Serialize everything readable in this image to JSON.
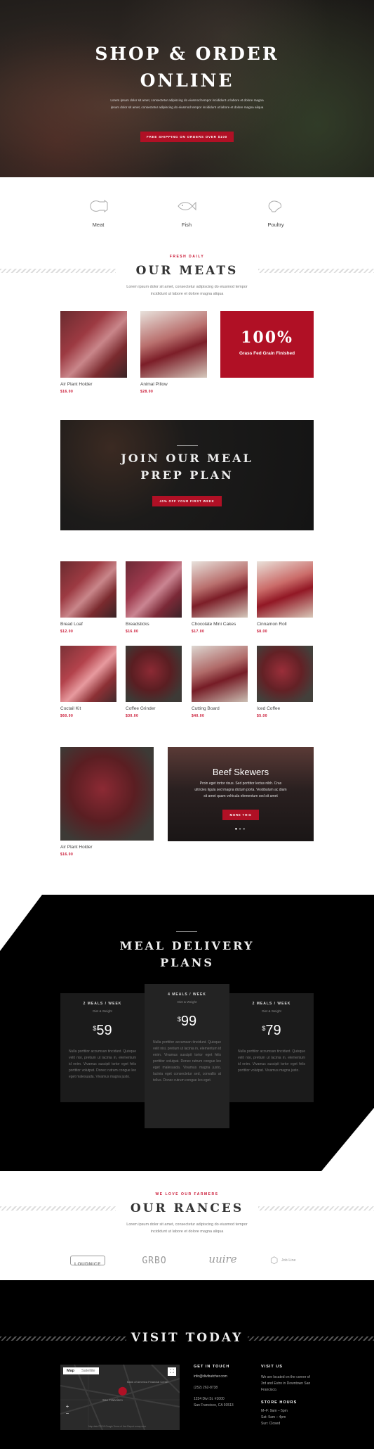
{
  "hero": {
    "title_line1": "SHOP & ORDER",
    "title_line2": "ONLINE",
    "subtitle_line1": "Lorem ipsum dolor sit amet, consectetur adipiscing do eiusmod tempor incididunt ut labore et dolore magna",
    "subtitle_line2": "ipsum dolor sit amet, consectetur adipiscing do eiusmod tempor incididunt ut labore et dolore magna aliqua",
    "cta": "FREE SHIPPING ON ORDERS OVER $100"
  },
  "categories": [
    {
      "label": "Meat",
      "icon": "meat-icon"
    },
    {
      "label": "Fish",
      "icon": "fish-icon"
    },
    {
      "label": "Poultry",
      "icon": "poultry-icon"
    }
  ],
  "meats": {
    "eyebrow": "FRESH DAILY",
    "title": "OUR MEATS",
    "desc_line1": "Lorem ipsum dolor sit amet, consectetur adipiscing do eiusmod tempor",
    "desc_line2": "incididunt ut labore et dolore magna aliqua",
    "products": [
      {
        "name": "Air Plant Holder",
        "price": "$16.00"
      },
      {
        "name": "Animal Pillow",
        "price": "$28.00"
      }
    ],
    "promo_big": "100%",
    "promo_small": "Grass Fed Grain Finished"
  },
  "meal_prep": {
    "title_line1": "JOIN OUR MEAL",
    "title_line2": "PREP PLAN",
    "cta": "40% OFF YOUR FIRST WEEK"
  },
  "grid": [
    {
      "name": "Bread Loaf",
      "price": "$12.00"
    },
    {
      "name": "Breadsticks",
      "price": "$16.00"
    },
    {
      "name": "Chocolate Mini Cakes",
      "price": "$17.00"
    },
    {
      "name": "Cinnamon Roll",
      "price": "$8.00"
    },
    {
      "name": "Coctail Kit",
      "price": "$60.00"
    },
    {
      "name": "Coffee Grinder",
      "price": "$30.00"
    },
    {
      "name": "Cutting Board",
      "price": "$40.00"
    },
    {
      "name": "Iced Coffee",
      "price": "$5.00"
    }
  ],
  "feature_product": {
    "name": "Air Plant Holder",
    "price": "$16.00"
  },
  "slider": {
    "title": "Beef Skewers",
    "text_line1": "Proin eget tortor risus. Sed porttitor lectus nibh. Cras",
    "text_line2": "ultricies ligula sed magna dictum porta. Vestibulum ac diam",
    "text_line3": "sit amet quam vehicula elementum sed sit amet",
    "cta": "MORE THIS"
  },
  "delivery": {
    "title_line1": "MEAL DELIVERY",
    "title_line2": "PLANS",
    "plans": [
      {
        "heading": "2 MEALS / WEEK",
        "sub": "Diet & Weight",
        "currency": "$",
        "price": "59",
        "desc": "Nulla porttitor accumsan tincidunt. Quisque velit nisi, pretium ut lacinia in, elementum id enim. Vivamus suscipit tortor eget felis porttitor volutpat. Donec rutrum congue leo eget malesuada. Vivamus magna justo."
      },
      {
        "heading": "4 MEALS / WEEK",
        "sub": "Diet & Weight",
        "currency": "$",
        "price": "99",
        "desc": "Nulla porttitor accumsan tincidunt. Quisque velit nisi, pretium ut lacinia in, elementum id enim. Vivamus suscipit tortor eget felis porttitor volutpat. Donec rutrum congue leo eget malesuada. Vivamus magna justo, lacinia eget consectetur sed, convallis at tellus. Donec rutrum congue leo eget."
      },
      {
        "heading": "2 MEALS / WEEK",
        "sub": "Diet & Weight",
        "currency": "$",
        "price": "79",
        "desc": "Nulla porttitor accumsan tincidunt. Quisque velit nisi, pretium ut lacinia in, elementum id enim. Vivamus suscipit tortor eget felis porttitor volutpat. Vivamus magna justo."
      }
    ]
  },
  "ranches": {
    "eyebrow": "WE LOVE OUR FARMERS",
    "title": "OUR RANCES",
    "desc_line1": "Lorem ipsum dolor sit amet, consectetur adipiscing do eiusmod tempor",
    "desc_line2": "incididunt ut labore et dolore magna aliqua",
    "logos": [
      "LOUDNICE",
      "GRBO",
      "uuire",
      "Job Line"
    ]
  },
  "visit": {
    "title": "VISIT TODAY",
    "map": {
      "tab_map": "Map",
      "tab_satellite": "Satellite",
      "label1": "San Francisco",
      "label2": "Bank of America Financial Center",
      "footer": "Map data ©2019 Google  Terms of Use  Report a map error"
    },
    "contact_heading": "GET IN TOUCH",
    "email": "info@divibutcher.com",
    "phone": "(252) 262-8738",
    "address1": "1234 Divi St. #1000",
    "address2": "San Francisco, CA 93513",
    "visit_heading": "VISIT US",
    "visit_text": "We are located on the corner of 3rd and Estro in Downtown San Francisco.",
    "hours_heading": "STORE HOURS",
    "hours": [
      "M–F: 9am – 5pm",
      "Sat: 9am – 4pm",
      "Sun: Closed"
    ]
  }
}
